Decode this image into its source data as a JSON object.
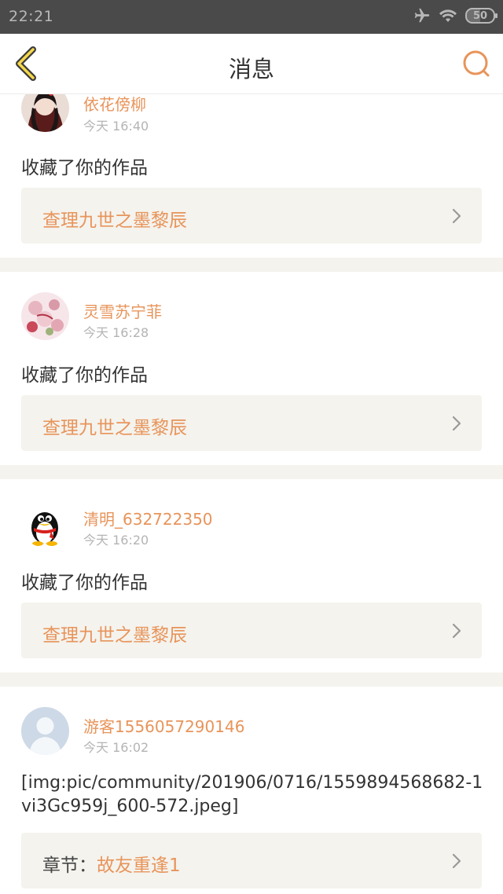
{
  "status_bar": {
    "time": "22:21",
    "battery": "50"
  },
  "header": {
    "title": "消息"
  },
  "feed": [
    {
      "username": "依花傍柳",
      "time": "今天 16:40",
      "message": "收藏了你的作品",
      "link_label": "查理九世之墨黎辰"
    },
    {
      "username": "灵雪苏宁菲",
      "time": "今天 16:28",
      "message": "收藏了你的作品",
      "link_label": "查理九世之墨黎辰"
    },
    {
      "username": "清明_632722350",
      "time": "今天 16:20",
      "message": "收藏了你的作品",
      "link_label": "查理九世之墨黎辰"
    },
    {
      "username": "游客1556057290146",
      "time": "今天 16:02",
      "message": "[img:pic/community/201906/0716/1559894568682-1vi3Gc959j_600-572.jpeg]",
      "link_prefix": "章节：",
      "link_label": "故友重逢1"
    }
  ],
  "colors": {
    "accent": "#e8945a",
    "status_bar": "#4a4a4a",
    "link_bg": "#f4f3ee",
    "divider": "#f4f3ee"
  },
  "icons": {
    "back": "back-chevron-icon",
    "search": "search-icon",
    "airplane": "airplane-icon",
    "wifi": "wifi-icon",
    "battery": "battery-icon",
    "chevron": "chevron-right-icon"
  }
}
